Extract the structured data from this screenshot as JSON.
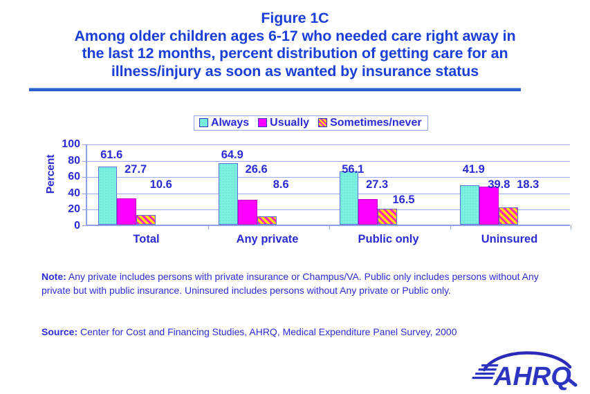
{
  "title": {
    "line1": "Figure 1C",
    "line2": "Among older children ages 6-17 who needed care right away in",
    "line3": "the last 12 months, percent distribution of getting care for an",
    "line4": "illness/injury as soon as wanted by insurance status"
  },
  "legend": {
    "items": [
      {
        "label": "Always",
        "swatch": "always-swatch"
      },
      {
        "label": "Usually",
        "swatch": "usually-swatch"
      },
      {
        "label": "Sometimes/never",
        "swatch": "sometimes-never-swatch"
      }
    ]
  },
  "axis": {
    "ylabel": "Percent",
    "yticks": [
      "100",
      "80",
      "60",
      "40",
      "20",
      "0"
    ]
  },
  "labels": {
    "g0": {
      "always": "61.6",
      "usually": "27.7",
      "some": "10.6"
    },
    "g1": {
      "always": "64.9",
      "usually": "26.6",
      "some": "8.6"
    },
    "g2": {
      "always": "56.1",
      "usually": "27.3",
      "some": "16.5"
    },
    "g3": {
      "always": "41.9",
      "usually": "39.8",
      "some": "18.3"
    }
  },
  "categories": {
    "c0": "Total",
    "c1": "Any private",
    "c2": "Public only",
    "c3": "Uninsured"
  },
  "footnotes": {
    "note_prefix": "Note:",
    "note_text": " Any private includes persons with private insurance or Champus/VA.  Public only includes persons without Any private but with public insurance. Uninsured includes persons without Any private or Public only.",
    "source_prefix": "Source:",
    "source_text": " Center for Cost and Financing Studies, AHRQ, Medical Expenditure Panel Survey, 2000"
  },
  "logo": {
    "text": "AHRQ"
  },
  "colors": {
    "text_blue": "#2b2bd6",
    "title_blue": "#1a3fd8",
    "always": "#7df0e0",
    "usually": "#ff00ff",
    "sometimes_never_base": "#ffe000",
    "sometimes_never_stripe": "#ff20c0",
    "gridline": "#9aa8ee",
    "divider": "#2a5fd0"
  },
  "chart_data": {
    "type": "bar",
    "title": "Among older children ages 6-17 who needed care right away in the last 12 months, percent distribution of getting care for an illness/injury as soon as wanted by insurance status",
    "subtitle": "Figure 1C",
    "xlabel": "",
    "ylabel": "Percent",
    "ylim": [
      0,
      100
    ],
    "yticks": [
      0,
      20,
      40,
      60,
      80,
      100
    ],
    "grid": true,
    "legend_position": "top-center",
    "categories": [
      "Total",
      "Any private",
      "Public only",
      "Uninsured"
    ],
    "series": [
      {
        "name": "Always",
        "values": [
          61.6,
          64.9,
          56.1,
          41.9
        ]
      },
      {
        "name": "Usually",
        "values": [
          27.7,
          26.6,
          27.3,
          39.8
        ]
      },
      {
        "name": "Sometimes/never",
        "values": [
          10.6,
          8.6,
          16.5,
          18.3
        ]
      }
    ],
    "note": "Any private includes persons with private insurance or Champus/VA.  Public only includes persons without Any private but with public insurance. Uninsured includes persons without Any private or Public only.",
    "source": "Center for Cost and Financing Studies, AHRQ, Medical Expenditure Panel Survey, 2000"
  }
}
